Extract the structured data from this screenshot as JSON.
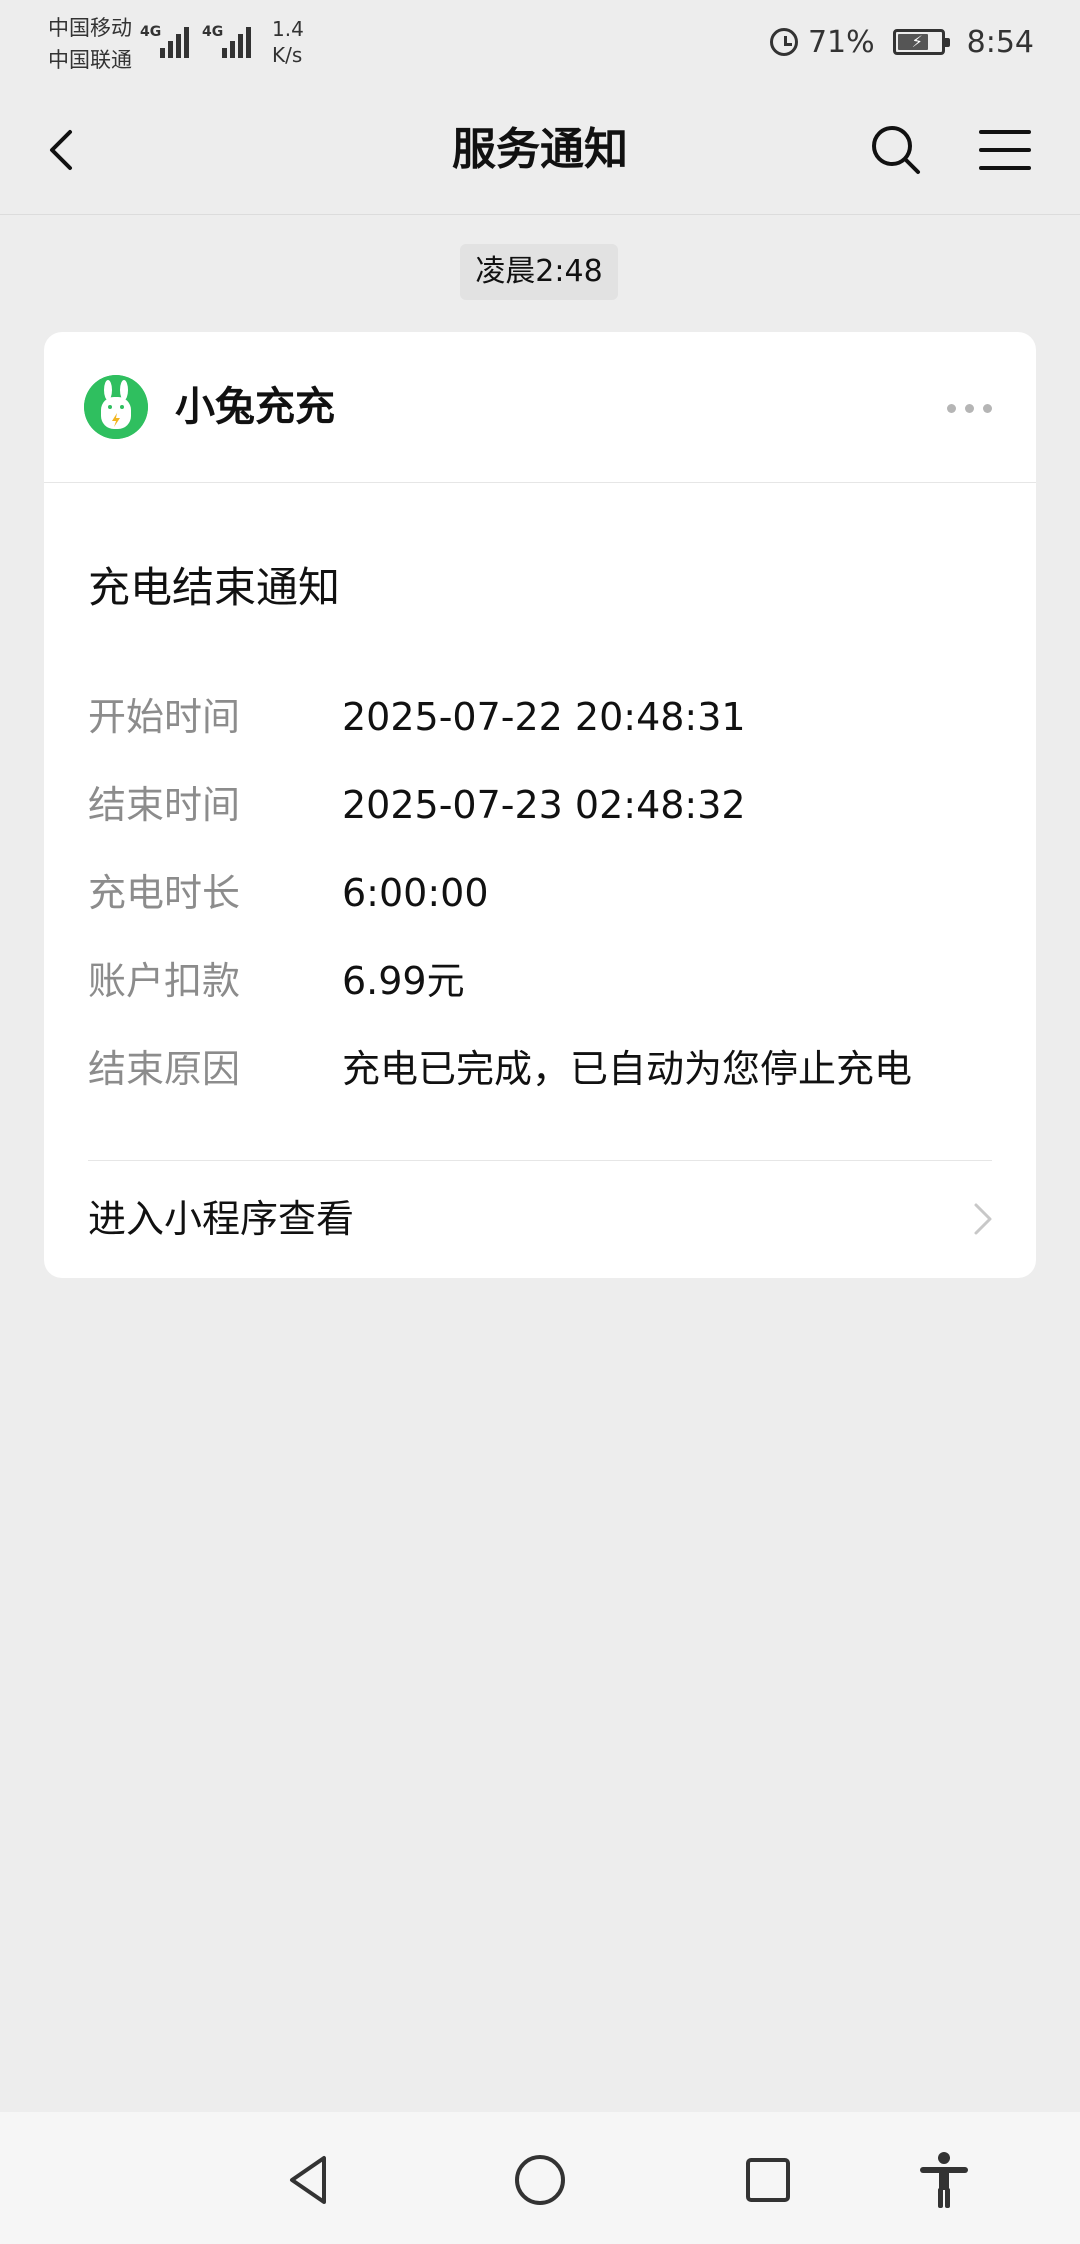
{
  "status_bar": {
    "carrier_1": "中国移动",
    "carrier_2": "中国联通",
    "network_1": "4G",
    "network_2": "4G",
    "speed_value": "1.4",
    "speed_unit": "K/s",
    "battery_percent": "71%",
    "battery_level": 0.71,
    "time": "8:54",
    "icons": [
      "signal-icon",
      "alarm-icon",
      "battery-icon"
    ]
  },
  "navbar": {
    "title": "服务通知",
    "icons": [
      "back-icon",
      "search-icon",
      "menu-icon"
    ]
  },
  "timestamp": "凌晨2:48",
  "card": {
    "app_name": "小兔充充",
    "app_color": "#2fbf5f",
    "notice_title": "充电结束通知",
    "rows": [
      {
        "label": "开始时间",
        "value": "2025-07-22 20:48:31"
      },
      {
        "label": "结束时间",
        "value": "2025-07-23 02:48:32"
      },
      {
        "label": "充电时长",
        "value": "6:00:00"
      },
      {
        "label": "账户扣款",
        "value": "6.99元"
      },
      {
        "label": "结束原因",
        "value": "充电已完成，已自动为您停止充电"
      }
    ],
    "footer_link": "进入小程序查看"
  },
  "colors": {
    "background": "#ededed",
    "card": "#ffffff",
    "label_gray": "#8c8c8c",
    "brand_green": "#2fbf5f"
  }
}
